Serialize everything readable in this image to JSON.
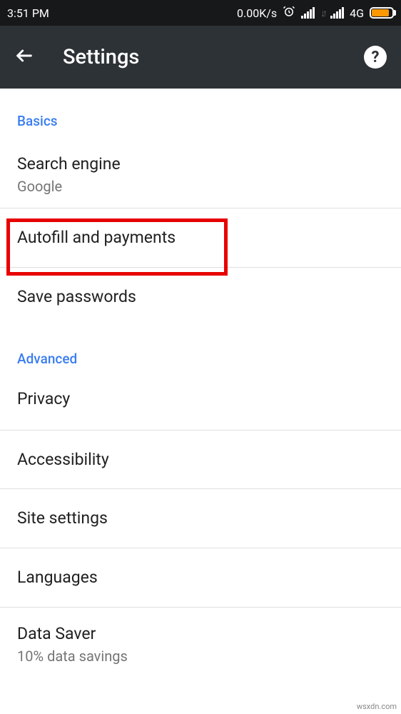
{
  "status_bar": {
    "time": "3:51 PM",
    "data_rate": "0.00K/s",
    "network_label": "4G"
  },
  "app_bar": {
    "title": "Settings"
  },
  "sections": {
    "basics": {
      "header": "Basics",
      "search_engine": {
        "title": "Search engine",
        "value": "Google"
      },
      "autofill": {
        "title": "Autofill and payments"
      },
      "save_passwords": {
        "title": "Save passwords"
      }
    },
    "advanced": {
      "header": "Advanced",
      "privacy": {
        "title": "Privacy"
      },
      "accessibility": {
        "title": "Accessibility"
      },
      "site_settings": {
        "title": "Site settings"
      },
      "languages": {
        "title": "Languages"
      },
      "data_saver": {
        "title": "Data Saver",
        "value": "10% data savings"
      }
    }
  },
  "watermark": "wsxdn.com"
}
